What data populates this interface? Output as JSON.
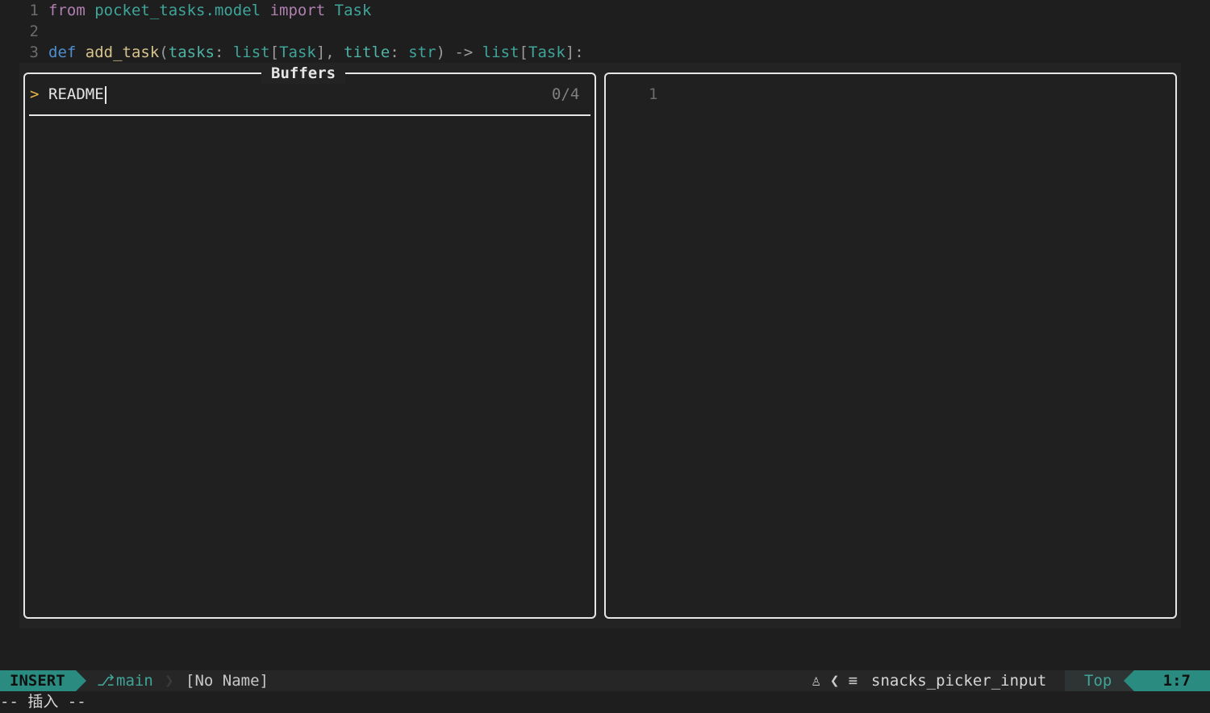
{
  "editor": {
    "lines": [
      {
        "num": "1",
        "tokens": [
          "from",
          "pocket_tasks.model",
          "import",
          "Task"
        ]
      },
      {
        "num": "2",
        "tokens": []
      },
      {
        "num": "3",
        "tokens": [
          "def",
          "add_task",
          "(",
          "tasks",
          ": ",
          "list",
          "[",
          "Task",
          "], ",
          "title",
          ": ",
          "str",
          ") -> ",
          "list",
          "[",
          "Task",
          "]:"
        ]
      }
    ]
  },
  "picker": {
    "title": "Buffers",
    "prompt_icon": ">",
    "query": "README",
    "count": "0/4",
    "preview_line_number": "1"
  },
  "statusline": {
    "mode": "INSERT",
    "branch_icon": "git-branch-icon",
    "branch": "main",
    "filename": "[No Name]",
    "os_icon": "linux-icon",
    "filetype_icon": "lines-icon",
    "filetype": "snacks_picker_input",
    "scroll": "Top",
    "position": "1:7"
  },
  "cmdline": "-- 插入 --",
  "colors": {
    "accent": "#2a8c80",
    "prompt": "#e8b54a",
    "background": "#1e1e1e"
  }
}
